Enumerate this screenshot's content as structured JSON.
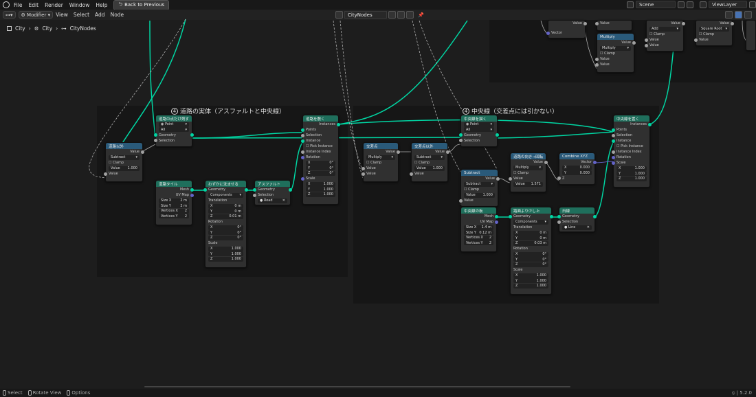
{
  "menu": {
    "file": "File",
    "edit": "Edit",
    "render": "Render",
    "window": "Window",
    "help": "Help",
    "back": "Back to Previous"
  },
  "scene": {
    "name": "Scene",
    "view_layer": "ViewLayer"
  },
  "editor": {
    "mode": "Modifier",
    "view": "View",
    "select": "Select",
    "add": "Add",
    "node": "Node",
    "tree_name": "CityNodes"
  },
  "breadcrumb": {
    "obj": "City",
    "modifier": "City",
    "tree": "CityNodes"
  },
  "frames": {
    "road": {
      "num": "4",
      "label": "道路の実体（アスファルトと中央線）"
    },
    "center": {
      "num": "4",
      "label": "中央線（交差点には引かない）"
    }
  },
  "nodes": {
    "road_abs": {
      "title": "道路以外",
      "value": "Value",
      "op": "Subtract",
      "clamp": "Clamp",
      "field_label": "Value",
      "field_val": "1.000",
      "in": "Value"
    },
    "road_pts": {
      "title": "道路の点だけ残す",
      "mode": "Point",
      "domain": "All",
      "geometry": "Geometry",
      "selection": "Selection"
    },
    "inst_road": {
      "title": "道路を敷く",
      "instances": "Instances",
      "points": "Points",
      "selection": "Selection",
      "instance": "Instance",
      "pick": "Pick Instance",
      "index": "Instance Index",
      "rotation": "Rotation",
      "rx": "0°",
      "ry": "0°",
      "rz": "0°",
      "scale": "Scale",
      "sx": "1.000",
      "sy": "1.000",
      "sz": "1.000"
    },
    "tile": {
      "title": "道路タイル",
      "mesh": "Mesh",
      "uv": "UV Map",
      "size_x_l": "Size X",
      "size_x": "2 m",
      "size_y_l": "Size Y",
      "size_y": "2 m",
      "vx_l": "Vertices X",
      "vx": "2",
      "vy_l": "Vertices Y",
      "vy": "2"
    },
    "lower": {
      "title": "わずかに沈ませる",
      "geometry": "Geometry",
      "mode": "Components",
      "translation": "Translation",
      "tx": "0 m",
      "ty": "0 m",
      "tz": "0.01 m",
      "rotation": "Rotation",
      "rx": "0°",
      "ry": "0°",
      "rz": "0°",
      "scale": "Scale",
      "sx": "1.000",
      "sy": "1.000",
      "sz": "1.000"
    },
    "asphalt": {
      "title": "アスファルト",
      "geometry": "Geometry",
      "selection": "Selection",
      "material": "Road"
    },
    "cross": {
      "title": "交差点",
      "value": "Value",
      "op": "Multiply",
      "clamp": "Clamp",
      "in1": "Value",
      "in2": "Value"
    },
    "cross_ex": {
      "title": "交差点以外",
      "value": "Value",
      "op": "Subtract",
      "clamp": "Clamp",
      "field_label": "Value",
      "field_val": "1.000",
      "in": "Value"
    },
    "center_pts": {
      "title": "中央線を描く",
      "mode": "Point",
      "domain": "All",
      "geometry": "Geometry",
      "selection": "Selection"
    },
    "subtract": {
      "title": "Subtract",
      "value": "Value",
      "op": "Subtract",
      "clamp": "Clamp",
      "field_label": "Value",
      "field_val": "1.000",
      "in": "Value"
    },
    "dir_rot": {
      "title": "道路の向き→回転",
      "value": "Value",
      "op": "Multiply",
      "clamp": "Clamp",
      "field_label": "Value",
      "field_val": "1.571",
      "in": "Value"
    },
    "combine": {
      "title": "Combine XYZ",
      "vector": "Vector",
      "x_l": "X",
      "x": "0.000",
      "y_l": "Y",
      "y": "0.000",
      "z": "Z"
    },
    "inst_center": {
      "title": "中央線を置く",
      "instances": "Instances",
      "points": "Points",
      "selection": "Selection",
      "instance": "Instance",
      "pick": "Pick Instance",
      "index": "Instance Index",
      "rotation": "Rotation",
      "scale": "Scale",
      "sx": "1.000",
      "sy": "1.000",
      "sz": "1.000"
    },
    "center_plane": {
      "title": "中央線の板",
      "mesh": "Mesh",
      "uv": "UV Map",
      "size_x_l": "Size X",
      "size_x": "1.4 m",
      "size_y_l": "Size Y",
      "size_y": "0.12 m",
      "vx_l": "Vertices X",
      "vx": "2",
      "vy_l": "Vertices Y",
      "vy": "2"
    },
    "lift": {
      "title": "路面より少し上",
      "geometry": "Geometry",
      "mode": "Components",
      "translation": "Translation",
      "tx": "0 m",
      "ty": "0 m",
      "tz": "0.03 m",
      "rotation": "Rotation",
      "rx": "0°",
      "ry": "0°",
      "rz": "0°",
      "scale": "Scale",
      "sx": "1.000",
      "sy": "1.000",
      "sz": "1.000"
    },
    "white": {
      "title": "白線",
      "geometry": "Geometry",
      "selection": "Selection",
      "material": "Line"
    },
    "top_vec": {
      "value": "Value",
      "vector": "Vector"
    },
    "top_multiply": {
      "title": "Multiply",
      "value": "Value",
      "op": "Multiply",
      "clamp": "Clamp",
      "in1": "Value",
      "in2": "Value",
      "in3": "Value",
      "in4": "Value"
    },
    "top_add": {
      "value": "Value",
      "op": "Add",
      "clamp": "Clamp",
      "in1": "Value",
      "in2": "Value"
    },
    "top_sqrt": {
      "value": "Value",
      "op": "Square Root",
      "clamp": "Clamp",
      "in": "Value"
    }
  },
  "status": {
    "select": "Select",
    "rotate": "Rotate View",
    "options": "Options",
    "version": "5.2.0"
  },
  "colors": {
    "geo_link": "#00d6a3",
    "value_link": "#a1a1a1",
    "frame_bg": "#161616",
    "canvas": "#1d1d1d"
  }
}
